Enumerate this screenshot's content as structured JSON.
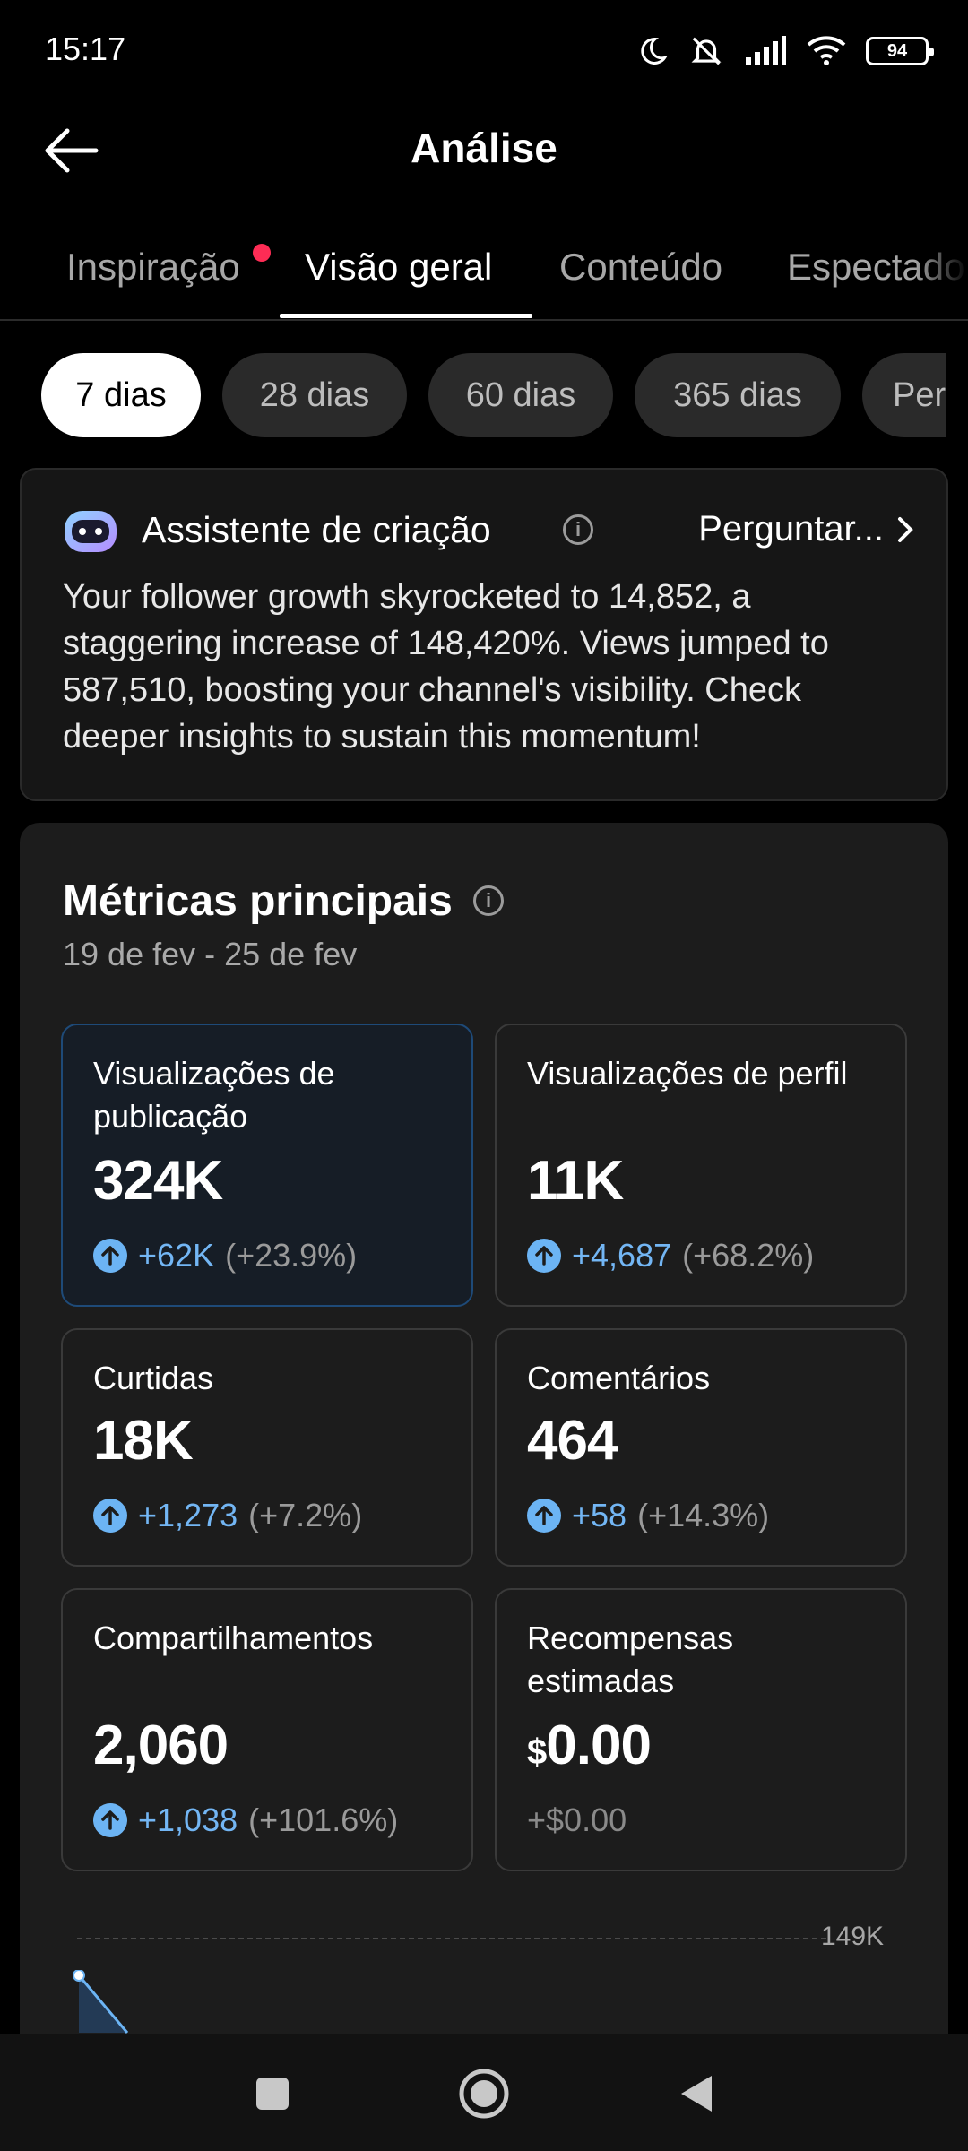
{
  "status": {
    "time": "15:17",
    "battery": "94"
  },
  "header": {
    "title": "Análise"
  },
  "tabs": [
    {
      "label": "Inspiração"
    },
    {
      "label": "Visão geral"
    },
    {
      "label": "Conteúdo"
    },
    {
      "label": "Espectado"
    }
  ],
  "chips": [
    {
      "label": "7 dias"
    },
    {
      "label": "28 dias"
    },
    {
      "label": "60 dias"
    },
    {
      "label": "365 dias"
    },
    {
      "label": "Per"
    }
  ],
  "assistant": {
    "title": "Assistente de criação",
    "ask_label": "Perguntar...",
    "summary": "Your follower growth skyrocketed to 14,852, a staggering increase of 148,420%. Views jumped to 587,510, boosting your channel's visibility. Check deeper insights to sustain this momentum!"
  },
  "metrics": {
    "title": "Métricas principais",
    "date_range": "19 de fev - 25 de fev",
    "tiles": [
      {
        "label": "Visualizações de publicação",
        "value": "324K",
        "delta": "+62K",
        "pct": "(+23.9%)"
      },
      {
        "label": "Visualizações de perfil",
        "value": "11K",
        "delta": "+4,687",
        "pct": "(+68.2%)"
      },
      {
        "label": "Curtidas",
        "value": "18K",
        "delta": "+1,273",
        "pct": "(+7.2%)"
      },
      {
        "label": "Comentários",
        "value": "464",
        "delta": "+58",
        "pct": "(+14.3%)"
      },
      {
        "label": "Compartilhamentos",
        "value": "2,060",
        "delta": "+1,038",
        "pct": "(+101.6%)"
      },
      {
        "label": "Recompensas estimadas",
        "currency": "$",
        "value": "0.00",
        "change_text": "+$0.00"
      }
    ]
  },
  "chart": {
    "max_label": "149K"
  },
  "colors": {
    "accent_blue": "#73b6f4",
    "notification_dot": "#fe2c55",
    "selected_chip": "#ffffff"
  }
}
